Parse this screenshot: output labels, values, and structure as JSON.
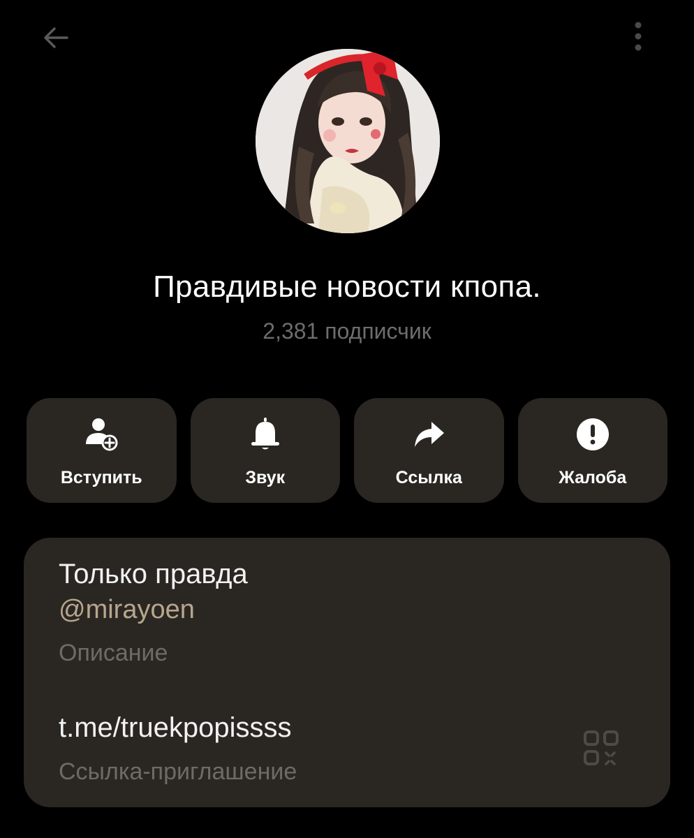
{
  "header": {
    "back_icon": "arrow-left-icon",
    "menu_icon": "more-vertical-icon"
  },
  "channel": {
    "name": "Правдивые новости кпопа.",
    "subscribers": "2,381 подписчик"
  },
  "actions": [
    {
      "label": "Вступить",
      "icon": "add-user-icon"
    },
    {
      "label": "Звук",
      "icon": "bell-icon"
    },
    {
      "label": "Ссылка",
      "icon": "share-icon"
    },
    {
      "label": "Жалоба",
      "icon": "alert-icon"
    }
  ],
  "info": {
    "title": "Только правда",
    "handle": "@mirayoen",
    "description_label": "Описание",
    "link": "t.me/truekpopissss",
    "link_label": "Ссылка-приглашение",
    "qr_icon": "qr-code-icon"
  },
  "colors": {
    "background": "#000000",
    "card": "#2a2723",
    "handle": "#b8a68d",
    "secondary_text": "#6f6a64"
  }
}
